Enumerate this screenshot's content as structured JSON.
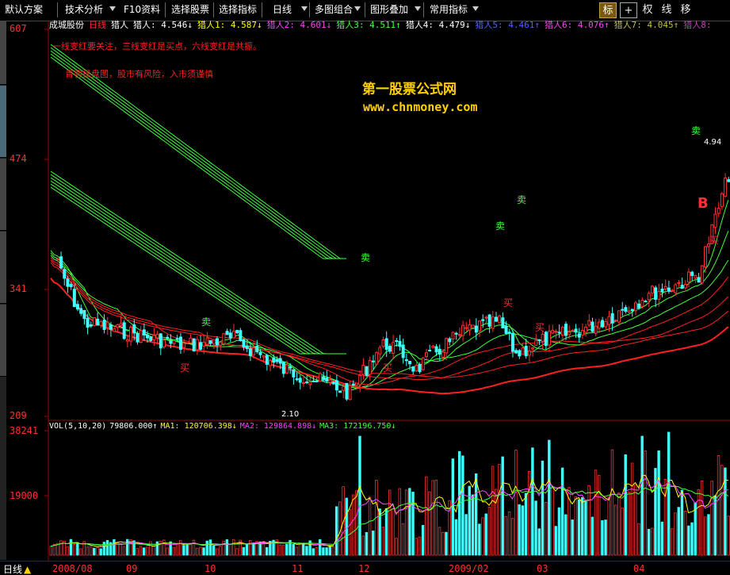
{
  "toolbar": {
    "items": [
      "默认方案",
      "技术分析",
      "F10资料",
      "选择股票",
      "选择指标",
      "日线",
      "多图组合",
      "图形叠加",
      "常用指标"
    ],
    "right_buttons": [
      "标",
      "+",
      "权",
      "线",
      "移"
    ],
    "active_right": 0
  },
  "legend": {
    "stock_name": "成城股份",
    "period": "日线",
    "indicator": "猎人",
    "values": [
      {
        "label": "猎人: 4.546↓",
        "color": "#ffffff"
      },
      {
        "label": "猎人1: 4.587↓",
        "color": "#ffff00"
      },
      {
        "label": "猎人2: 4.601↓",
        "color": "#ff40ff"
      },
      {
        "label": "猎人3: 4.511↑",
        "color": "#40ff40"
      },
      {
        "label": "猎人4: 4.479↓",
        "color": "#ffffff"
      },
      {
        "label": "猎人5: 4.461↑",
        "color": "#4040ff"
      },
      {
        "label": "猎人6: 4.076↑",
        "color": "#ff40ff"
      },
      {
        "label": "猎人7: 4.045↑",
        "color": "#c0c040"
      },
      {
        "label": "猎人8:",
        "color": "#c040c0"
      }
    ]
  },
  "notes": {
    "line1": "一线变红要关注，三线变红是买点，六线变红是共振。",
    "line2": "青客操盘图，股市有风险，入市须谨慎"
  },
  "watermark": {
    "title": "第一股票公式网",
    "url": "www.chnmoney.com"
  },
  "price_axis": {
    "labels": [
      "607",
      "474",
      "341",
      "209"
    ]
  },
  "volume_axis": {
    "labels": [
      "38241",
      "19000"
    ]
  },
  "price_markers": {
    "high": "4.94",
    "low": "2.10"
  },
  "signals": {
    "buy": "买",
    "sell": "卖",
    "b": "B"
  },
  "volume_legend": [
    {
      "label": "VOL(5,10,20)",
      "color": "#ffffff"
    },
    {
      "label": "79806.000↑",
      "color": "#ffffff"
    },
    {
      "label": "MA1: 120706.398↓",
      "color": "#ffff00"
    },
    {
      "label": "MA2: 129864.898↓",
      "color": "#ff40ff"
    },
    {
      "label": "MA3: 172196.750↓",
      "color": "#40ff40"
    }
  ],
  "bottom": {
    "period": "日线",
    "dates": [
      "2008/08",
      "09",
      "10",
      "11",
      "12",
      "2009/02",
      "03",
      "04"
    ]
  },
  "chart_data": {
    "type": "candlestick",
    "title": "成城股份 日线",
    "y_ticks": [
      2.09,
      3.41,
      4.74,
      6.07
    ],
    "volume_ticks": [
      19000,
      38241
    ],
    "annotated_high": 4.94,
    "annotated_low": 2.1
  },
  "colors": {
    "up": "#ff3030",
    "down": "#40ffff",
    "axis": "#800000",
    "green_ma": "#40ff40",
    "red_ma": "#ff2020"
  }
}
